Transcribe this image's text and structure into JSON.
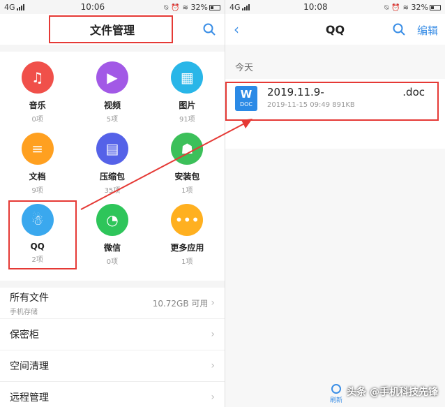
{
  "left": {
    "status": {
      "network": "4G",
      "time": "10:06",
      "battery": "32%",
      "battery_level": 0.32
    },
    "title": "文件管理",
    "categories": [
      {
        "name": "音乐",
        "count": "0项",
        "color": "#f0504a",
        "glyph": "♫",
        "icon": "music-icon"
      },
      {
        "name": "视频",
        "count": "5项",
        "color": "#a259e6",
        "glyph": "▶",
        "icon": "play-icon"
      },
      {
        "name": "图片",
        "count": "91项",
        "color": "#29b6e8",
        "glyph": "▦",
        "icon": "image-icon"
      },
      {
        "name": "文档",
        "count": "9项",
        "color": "#ffa020",
        "glyph": "≡",
        "icon": "document-icon"
      },
      {
        "name": "压缩包",
        "count": "35项",
        "color": "#5562e8",
        "glyph": "▤",
        "icon": "archive-icon"
      },
      {
        "name": "安装包",
        "count": "1项",
        "color": "#3cc05a",
        "glyph": "☗",
        "icon": "android-icon"
      },
      {
        "name": "QQ",
        "count": "2项",
        "color": "#3aa8ee",
        "glyph": "☃",
        "icon": "qq-icon"
      },
      {
        "name": "微信",
        "count": "0项",
        "color": "#2ec55a",
        "glyph": "◔",
        "icon": "wechat-icon"
      },
      {
        "name": "更多应用",
        "count": "1项",
        "color": "#ffb020",
        "glyph": "•••",
        "icon": "more-icon"
      }
    ],
    "rows": [
      {
        "label": "所有文件",
        "sub": "手机存储",
        "value": "10.72GB 可用"
      },
      {
        "label": "保密柜",
        "sub": "",
        "value": ""
      },
      {
        "label": "空间清理",
        "sub": "",
        "value": ""
      },
      {
        "label": "远程管理",
        "sub": "",
        "value": ""
      }
    ]
  },
  "right": {
    "status": {
      "network": "4G",
      "time": "10:08",
      "battery": "32%",
      "battery_level": 0.32
    },
    "title": "QQ",
    "edit": "编辑",
    "section": "今天",
    "file": {
      "icon_letter": "W",
      "icon_type": "DOC",
      "name": "2019.11.9-",
      "ext": ".doc",
      "meta": "2019-11-15 09:49   891KB"
    },
    "refresh": "刷新"
  },
  "watermark": "头条 @手机科技先锋",
  "colors": {
    "accent": "#3a8ee6",
    "highlight": "#e53935"
  }
}
